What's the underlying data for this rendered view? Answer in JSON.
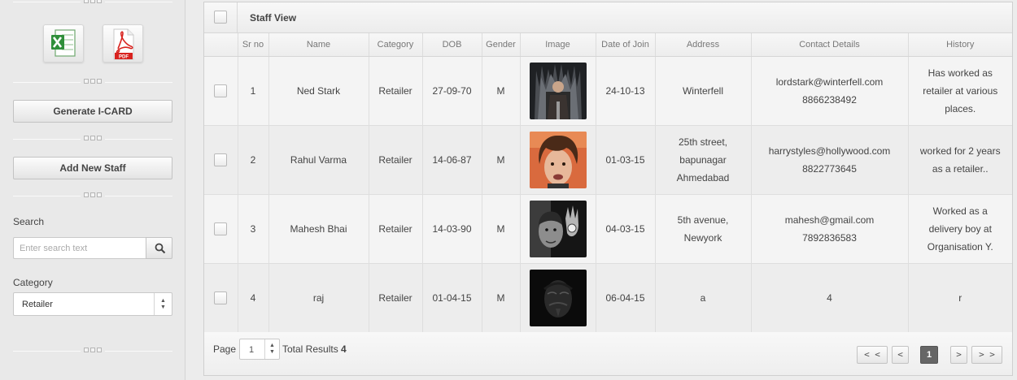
{
  "sidebar": {
    "export_excel_icon": "excel-icon",
    "export_pdf_icon": "pdf-icon",
    "pdf_icon_text": "PDF",
    "generate_icard_label": "Generate I-CARD",
    "add_staff_label": "Add New Staff",
    "search_label": "Search",
    "search_placeholder": "Enter search text",
    "search_icon": "search-icon",
    "category_label": "Category",
    "category_value": "Retailer"
  },
  "panel": {
    "title": "Staff View",
    "columns": [
      "Sr no",
      "Name",
      "Category",
      "DOB",
      "Gender",
      "Image",
      "Date of Join",
      "Address",
      "Contact Details",
      "History"
    ],
    "rows": [
      {
        "sr": "1",
        "name": "Ned Stark",
        "category": "Retailer",
        "dob": "27-09-70",
        "gender": "M",
        "image": "man-on-iron-throne-photo",
        "doj": "24-10-13",
        "address": [
          "Winterfell"
        ],
        "contact": [
          "lordstark@winterfell.com",
          "8866238492"
        ],
        "history": [
          "Has worked as",
          "retailer at various",
          "places."
        ]
      },
      {
        "sr": "2",
        "name": "Rahul Varma",
        "category": "Retailer",
        "dob": "14-06-87",
        "gender": "M",
        "image": "curly-haired-man-photo",
        "doj": "01-03-15",
        "address": [
          "25th street,",
          "bapunagar",
          "Ahmedabad"
        ],
        "contact": [
          "harrystyles@hollywood.com",
          "8822773645"
        ],
        "history": [
          "worked for 2 years",
          "as a retailer.."
        ]
      },
      {
        "sr": "3",
        "name": "Mahesh Bhai",
        "category": "Retailer",
        "dob": "14-03-90",
        "gender": "M",
        "image": "man-portrait-dark-photo",
        "doj": "04-03-15",
        "address": [
          "5th avenue,",
          "Newyork"
        ],
        "contact": [
          "mahesh@gmail.com",
          "7892836583"
        ],
        "history": [
          "Worked as a",
          "delivery boy at",
          "Organisation Y."
        ]
      },
      {
        "sr": "4",
        "name": "raj",
        "category": "Retailer",
        "dob": "01-04-15",
        "gender": "M",
        "image": "masked-face-photo",
        "doj": "06-04-15",
        "address": [
          "a"
        ],
        "contact": [
          "4"
        ],
        "history": [
          "r"
        ]
      }
    ]
  },
  "footer": {
    "page_label": "Page",
    "page_value": "1",
    "total_label": "Total Results",
    "total_count": "4",
    "first_label": "< <",
    "prev_label": "<",
    "current_page": "1",
    "next_label": ">",
    "last_label": "> >"
  }
}
